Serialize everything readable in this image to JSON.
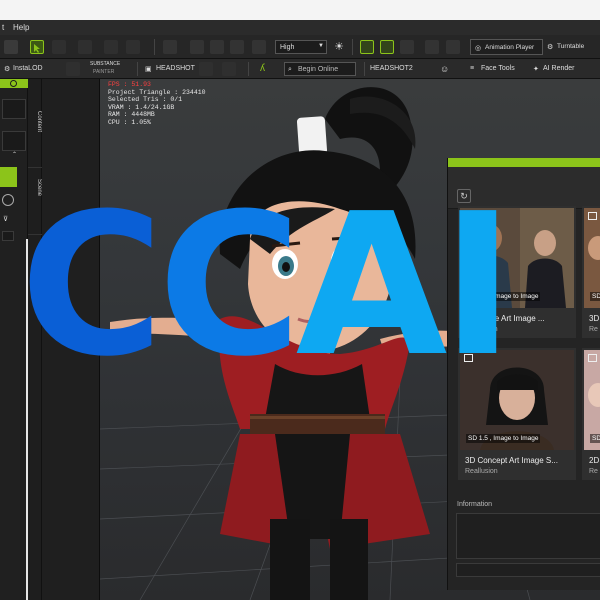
{
  "menubar": {
    "items": [
      "t",
      "Help"
    ]
  },
  "toolbar1": {
    "quality_select": "High",
    "animation_player": "Animation Player",
    "turntable": "Turntable"
  },
  "toolbar2": {
    "instalod": "InstaLOD",
    "substance_top": "SUBSTANCE",
    "substance_bottom": "PAINTER",
    "headshot": "HEADSHOT",
    "begin_online": "Begin Online",
    "headshot2": "HEADSHOT2",
    "face_tools": "Face Tools",
    "ai_render": "AI Render"
  },
  "side_tabs": {
    "content": "Content",
    "scene": "Scene",
    "visual": "Visu"
  },
  "viewport_stats": {
    "fps": "FPS : 51.93",
    "project_triangle": "Project Triangle : 234410",
    "selected_tris": "Selected Tris : 0/1",
    "vram": "VRAM : 1.4/24.1GB",
    "ram": "RAM : 4448MB",
    "cpu": "CPU : 1.05%"
  },
  "store_panel": {
    "cards": [
      {
        "badge": "SD 1.5 , Image to Image",
        "title": "2D Game Art Image ...",
        "subtitle": "Reallusion"
      },
      {
        "badge": "SD",
        "title": "3D",
        "subtitle": "Re"
      },
      {
        "badge": "SD 1.5 , Image to Image",
        "title": "3D Concept Art Image S...",
        "subtitle": "Reallusion"
      },
      {
        "badge": "SD",
        "title": "2D",
        "subtitle": "Re"
      }
    ],
    "information_label": "Information"
  },
  "overlay_logo": {
    "part1": "C",
    "part2": "C",
    "part3": "AI"
  },
  "colors": {
    "accent": "#8cc41a",
    "logo_dark": "#0a5fd6",
    "logo_light": "#0ea8f2",
    "fps_red": "#ff4040"
  }
}
